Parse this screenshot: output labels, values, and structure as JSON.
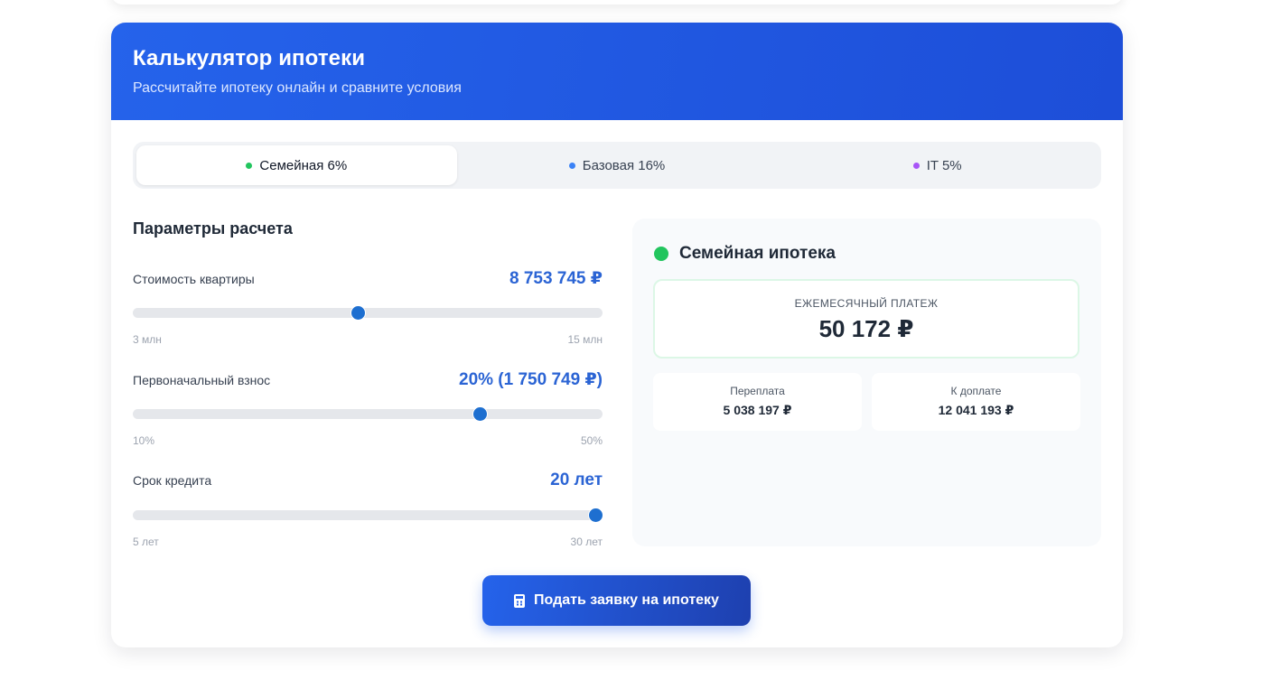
{
  "header": {
    "title": "Калькулятор ипотеки",
    "subtitle": "Рассчитайте ипотеку онлайн и сравните условия"
  },
  "tabs": [
    {
      "label": "Семейная 6%",
      "dot_color": "#22c55e",
      "active": true
    },
    {
      "label": "Базовая 16%",
      "dot_color": "#3b82f6",
      "active": false
    },
    {
      "label": "IT 5%",
      "dot_color": "#a855f7",
      "active": false
    }
  ],
  "params": {
    "title": "Параметры расчета",
    "price": {
      "label": "Стоимость квартиры",
      "value": "8 753 745 ₽",
      "min": "3 млн",
      "max": "15 млн",
      "level": 0.48
    },
    "down_payment": {
      "label": "Первоначальный взнос",
      "value": "20% (1 750 749 ₽)",
      "min": "10%",
      "max": "50%",
      "level": 0.74
    },
    "term": {
      "label": "Срок кредита",
      "value": "20 лет",
      "min": "5 лет",
      "max": "30 лет",
      "level": 0.985
    }
  },
  "result": {
    "title": "Семейная ипотека",
    "accent": "#22c55e",
    "monthly_caption": "ЕЖЕМЕСЯЧНЫЙ ПЛАТЕЖ",
    "monthly_amount": "50 172 ₽",
    "overpay_caption": "Переплата",
    "overpay_amount": "5 038 197 ₽",
    "total_caption": "К доплате",
    "total_amount": "12 041 193 ₽"
  },
  "apply": {
    "label": "Подать заявку на ипотеку",
    "icon": "calculator-icon"
  }
}
